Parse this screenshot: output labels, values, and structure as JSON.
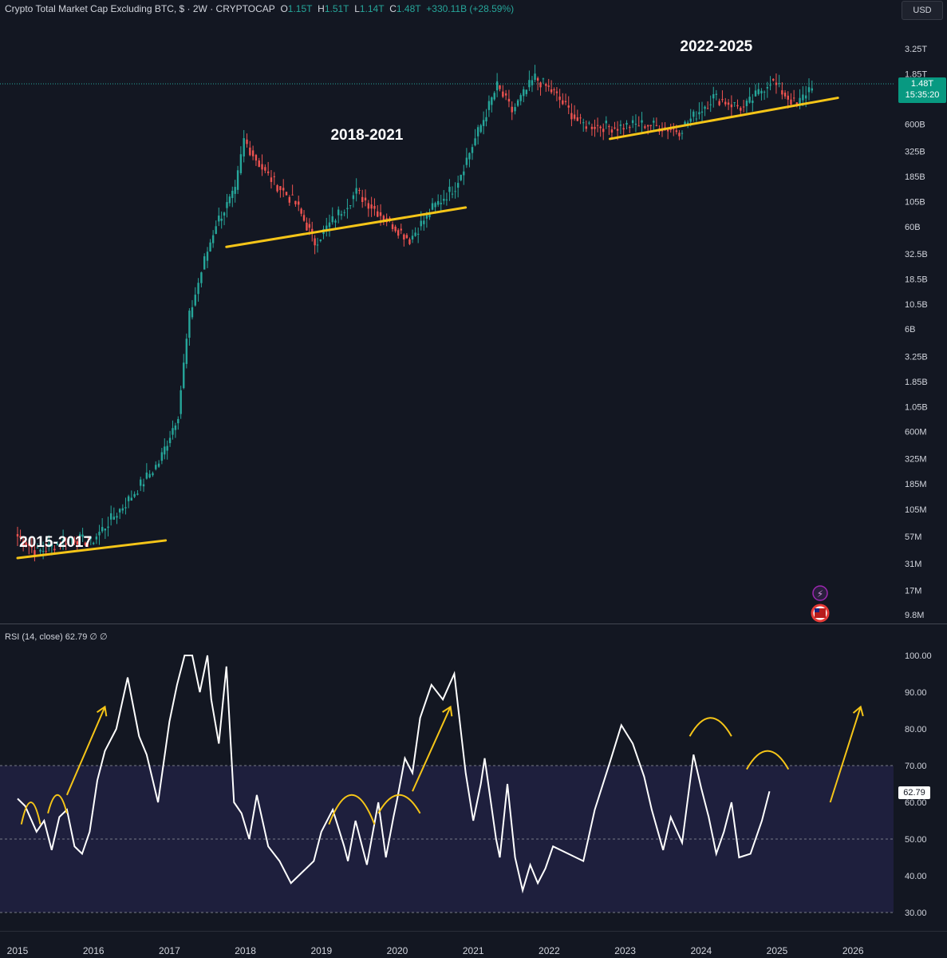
{
  "header": {
    "symbol": "Crypto Total Market Cap Excluding BTC, $ · 2W · CRYPTOCAP",
    "open_label": "O",
    "open": "1.15T",
    "high_label": "H",
    "high": "1.51T",
    "low_label": "L",
    "low": "1.14T",
    "close_label": "C",
    "close": "1.48T",
    "change": "+330.11B (+28.59%)"
  },
  "currency_button": "USD",
  "last_price": {
    "value": "1.48T",
    "countdown": "15:35:20"
  },
  "rsi_header": "RSI (14, close)  62.79  ∅  ∅",
  "rsi_last": "62.79",
  "colors": {
    "background": "#131722",
    "up": "#26a69a",
    "down": "#ef5350",
    "trendline": "#f5c518",
    "rsi_line": "#ffffff",
    "rsi_band": "#1e1f3d",
    "grid": "#2a2e39"
  },
  "icons": [
    "lightning-icon",
    "us-flag-icon"
  ],
  "chart_data": [
    {
      "type": "candlestick",
      "title": "Crypto Total Market Cap Excluding BTC, $ · 2W · CRYPTOCAP",
      "scale": "log",
      "ylabel": "USD",
      "y_tick_labels": [
        "3.25T",
        "1.85T",
        "600B",
        "325B",
        "185B",
        "105B",
        "60B",
        "32.5B",
        "18.5B",
        "10.5B",
        "6B",
        "3.25B",
        "1.85B",
        "1.05B",
        "600M",
        "325M",
        "185M",
        "105M",
        "57M",
        "31M",
        "17M",
        "9.8M"
      ],
      "x_tick_labels": [
        "2015",
        "2016",
        "2017",
        "2018",
        "2019",
        "2020",
        "2021",
        "2022",
        "2023",
        "2024",
        "2025",
        "2026"
      ],
      "annotations": [
        "2015-2017",
        "2018-2021",
        "2022-2025"
      ],
      "key_points": [
        {
          "x": 2015.0,
          "y": 60000000
        },
        {
          "x": 2015.3,
          "y": 40000000
        },
        {
          "x": 2015.75,
          "y": 55000000
        },
        {
          "x": 2016.0,
          "y": 50000000
        },
        {
          "x": 2016.5,
          "y": 130000000
        },
        {
          "x": 2016.9,
          "y": 300000000
        },
        {
          "x": 2017.15,
          "y": 900000000
        },
        {
          "x": 2017.3,
          "y": 8000000000
        },
        {
          "x": 2017.5,
          "y": 28000000000
        },
        {
          "x": 2017.65,
          "y": 65000000000
        },
        {
          "x": 2017.9,
          "y": 130000000000
        },
        {
          "x": 2018.02,
          "y": 420000000000
        },
        {
          "x": 2018.3,
          "y": 200000000000
        },
        {
          "x": 2018.7,
          "y": 100000000000
        },
        {
          "x": 2018.95,
          "y": 42000000000
        },
        {
          "x": 2019.5,
          "y": 130000000000
        },
        {
          "x": 2019.9,
          "y": 70000000000
        },
        {
          "x": 2020.2,
          "y": 45000000000
        },
        {
          "x": 2020.5,
          "y": 90000000000
        },
        {
          "x": 2020.8,
          "y": 150000000000
        },
        {
          "x": 2021.1,
          "y": 500000000000
        },
        {
          "x": 2021.35,
          "y": 1400000000000
        },
        {
          "x": 2021.55,
          "y": 800000000000
        },
        {
          "x": 2021.85,
          "y": 1700000000000
        },
        {
          "x": 2022.1,
          "y": 1200000000000
        },
        {
          "x": 2022.45,
          "y": 600000000000
        },
        {
          "x": 2022.9,
          "y": 560000000000
        },
        {
          "x": 2023.3,
          "y": 600000000000
        },
        {
          "x": 2023.75,
          "y": 520000000000
        },
        {
          "x": 2024.2,
          "y": 1100000000000
        },
        {
          "x": 2024.6,
          "y": 850000000000
        },
        {
          "x": 2024.95,
          "y": 1600000000000
        },
        {
          "x": 2025.3,
          "y": 900000000000
        },
        {
          "x": 2025.5,
          "y": 1480000000000
        }
      ],
      "trendlines": [
        {
          "from": {
            "x": 2015.0,
            "y": 35000000
          },
          "to": {
            "x": 2016.95,
            "y": 52000000
          }
        },
        {
          "from": {
            "x": 2017.75,
            "y": 38000000000
          },
          "to": {
            "x": 2020.9,
            "y": 92000000000
          }
        },
        {
          "from": {
            "x": 2022.8,
            "y": 430000000000
          },
          "to": {
            "x": 2025.8,
            "y": 1080000000000
          }
        }
      ],
      "last": 1480000000000
    },
    {
      "type": "line",
      "title": "RSI (14, close)",
      "ylim": [
        28,
        100
      ],
      "y_tick_labels": [
        "100.00",
        "90.00",
        "80.00",
        "70.00",
        "60.00",
        "50.00",
        "40.00",
        "30.00"
      ],
      "bands": {
        "upper": 70,
        "middle": 50,
        "lower": 30
      },
      "x": [
        2015.0,
        2015.1,
        2015.25,
        2015.35,
        2015.45,
        2015.55,
        2015.65,
        2015.75,
        2015.85,
        2015.95,
        2016.05,
        2016.15,
        2016.3,
        2016.45,
        2016.6,
        2016.7,
        2016.85,
        2017.0,
        2017.1,
        2017.2,
        2017.3,
        2017.4,
        2017.5,
        2017.55,
        2017.65,
        2017.75,
        2017.85,
        2017.95,
        2018.05,
        2018.15,
        2018.3,
        2018.45,
        2018.6,
        2018.75,
        2018.9,
        2019.0,
        2019.15,
        2019.3,
        2019.35,
        2019.45,
        2019.6,
        2019.75,
        2019.85,
        2019.95,
        2020.0,
        2020.1,
        2020.2,
        2020.3,
        2020.45,
        2020.6,
        2020.75,
        2020.9,
        2021.0,
        2021.1,
        2021.15,
        2021.3,
        2021.35,
        2021.45,
        2021.55,
        2021.65,
        2021.75,
        2021.85,
        2021.95,
        2022.05,
        2022.25,
        2022.45,
        2022.6,
        2022.8,
        2022.95,
        2023.1,
        2023.25,
        2023.35,
        2023.5,
        2023.6,
        2023.75,
        2023.9,
        2024.0,
        2024.1,
        2024.2,
        2024.3,
        2024.4,
        2024.5,
        2024.65,
        2024.8,
        2024.9,
        2025.0,
        2025.1,
        2025.2,
        2025.35,
        2025.45,
        2025.5
      ],
      "values": [
        61,
        59,
        52,
        55,
        47,
        56,
        58,
        48,
        46,
        52,
        66,
        74,
        80,
        94,
        78,
        73,
        60,
        82,
        92,
        100,
        100,
        90,
        100,
        88,
        76,
        97,
        60,
        57,
        50,
        62,
        48,
        44,
        38,
        41,
        44,
        52,
        58,
        48,
        44,
        55,
        43,
        60,
        45,
        56,
        61,
        72,
        68,
        83,
        92,
        88,
        95,
        68,
        55,
        65,
        72,
        50,
        45,
        65,
        45,
        36,
        43,
        38,
        42,
        48,
        46,
        44,
        58,
        71,
        81,
        76,
        67,
        58,
        47,
        56,
        49,
        73,
        64,
        56,
        46,
        52,
        60,
        45,
        46,
        55,
        63
      ],
      "last": 62.79,
      "annotations": [
        "up-arrow",
        "up-arrow",
        "up-arrow",
        "dome-arc"
      ]
    }
  ]
}
